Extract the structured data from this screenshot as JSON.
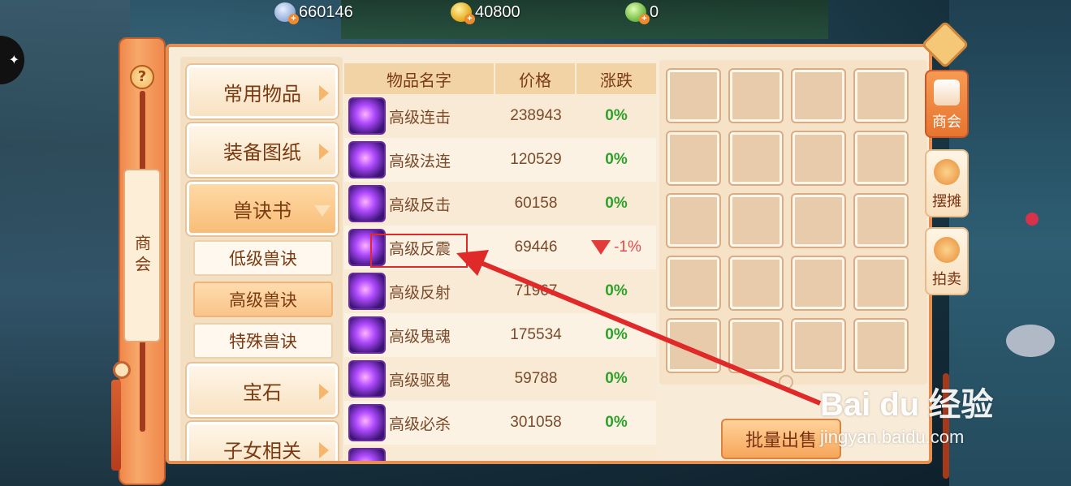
{
  "currencies": [
    {
      "name": "silver",
      "value": "660146",
      "color": "#a7bde8"
    },
    {
      "name": "gold",
      "value": "40800",
      "color": "#e1a515"
    },
    {
      "name": "jade",
      "value": "0",
      "color": "#66b43a"
    }
  ],
  "add_symbol": "+",
  "left_scroll": {
    "help": "?",
    "label": "商会"
  },
  "categories": [
    {
      "label": "常用物品"
    },
    {
      "label": "装备图纸"
    },
    {
      "label": "兽诀书",
      "expanded": true
    },
    {
      "label": "宝石"
    },
    {
      "label": "子女相关"
    }
  ],
  "subcategories": [
    {
      "label": "低级兽诀"
    },
    {
      "label": "高级兽诀",
      "active": true
    },
    {
      "label": "特殊兽诀"
    }
  ],
  "table": {
    "headers": [
      "物品名字",
      "价格",
      "涨跌"
    ],
    "rows": [
      {
        "name": "高级连击",
        "price": "238943",
        "change": "0%"
      },
      {
        "name": "高级法连",
        "price": "120529",
        "change": "0%"
      },
      {
        "name": "高级反击",
        "price": "60158",
        "change": "0%"
      },
      {
        "name": "高级反震",
        "price": "69446",
        "change": "-1%",
        "trend": "down"
      },
      {
        "name": "高级反射",
        "price": "71967",
        "change": "0%"
      },
      {
        "name": "高级鬼魂",
        "price": "175534",
        "change": "0%"
      },
      {
        "name": "高级驱鬼",
        "price": "59788",
        "change": "0%"
      },
      {
        "name": "高级必杀",
        "price": "301058",
        "change": "0%"
      }
    ]
  },
  "batch_sell_label": "批量出售",
  "side_tabs": [
    {
      "label": "商会",
      "icon": "guild-icon",
      "active": true
    },
    {
      "label": "摆摊",
      "icon": "stall-coins-icon"
    },
    {
      "label": "拍卖",
      "icon": "auction-coins-icon"
    }
  ],
  "watermark": {
    "logo": "Bai du 经验",
    "url": "jingyan.baidu.com"
  },
  "colors": {
    "accent": "#e48e51",
    "up": "#2da12a",
    "down": "#e53a3a",
    "annotation": "#e02a2a"
  }
}
